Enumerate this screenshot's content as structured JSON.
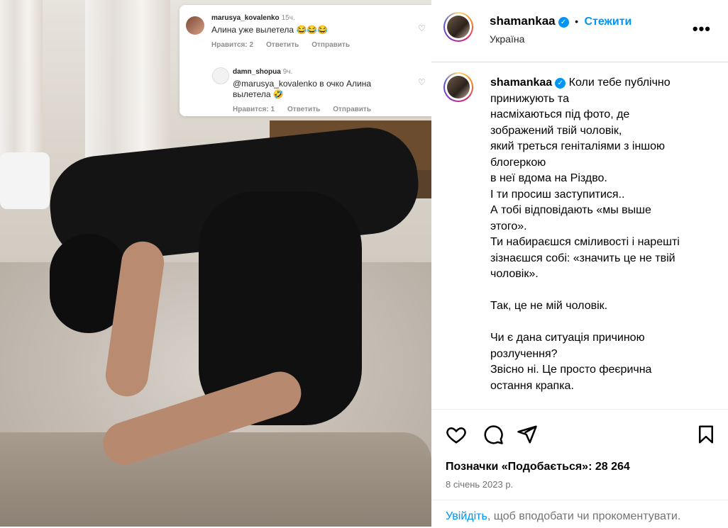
{
  "overlay": {
    "comment1": {
      "user": "marusya_kovalenko",
      "time": "15ч.",
      "text": "Алина уже вылетела 😂😂😂",
      "likes": "Нравится: 2",
      "reply": "Ответить",
      "send": "Отправить"
    },
    "comment2": {
      "user": "damn_shopua",
      "time": "9ч.",
      "text_line1": "@marusya_kovalenko в очко Алина",
      "text_line2": "вылетела 🤣",
      "likes": "Нравится: 1",
      "reply": "Ответить",
      "send": "Отправить"
    }
  },
  "post": {
    "username": "shamankaa",
    "bullet": "•",
    "follow": "Стежити",
    "location": "Україна",
    "more": "•••",
    "caption_lines": [
      "Коли тебе публічно",
      "принижують та",
      "насміхаються під фото, де",
      "зображений твій чоловік,",
      "який треться геніталіями з іншою",
      "блогеркою",
      "в неї вдома на Різдво.",
      "І ти просиш заступитися..",
      "А тобі відповідають «мы выше",
      "этого».",
      "Ти набираєшся сміливості і нарешті",
      "зізнаєшся собі: «значить це не твій",
      "чоловік».",
      "",
      "Так, це не мій чоловік.",
      "",
      "Чи є дана ситуація причиною",
      "розлучення?",
      "Звісно ні. Це просто феєрична",
      "остання крапка."
    ],
    "likes": "Позначки «Подобається»: 28 264",
    "date": "8 січень 2023 р.",
    "login_link": "Увійдіть",
    "login_text": ", щоб вподобати чи прокоментувати."
  },
  "icons": [
    "heart-icon",
    "comment-icon",
    "share-icon",
    "bookmark-icon",
    "verified-icon",
    "more-icon"
  ],
  "colors": {
    "accent": "#0095f6",
    "muted": "#737373"
  }
}
